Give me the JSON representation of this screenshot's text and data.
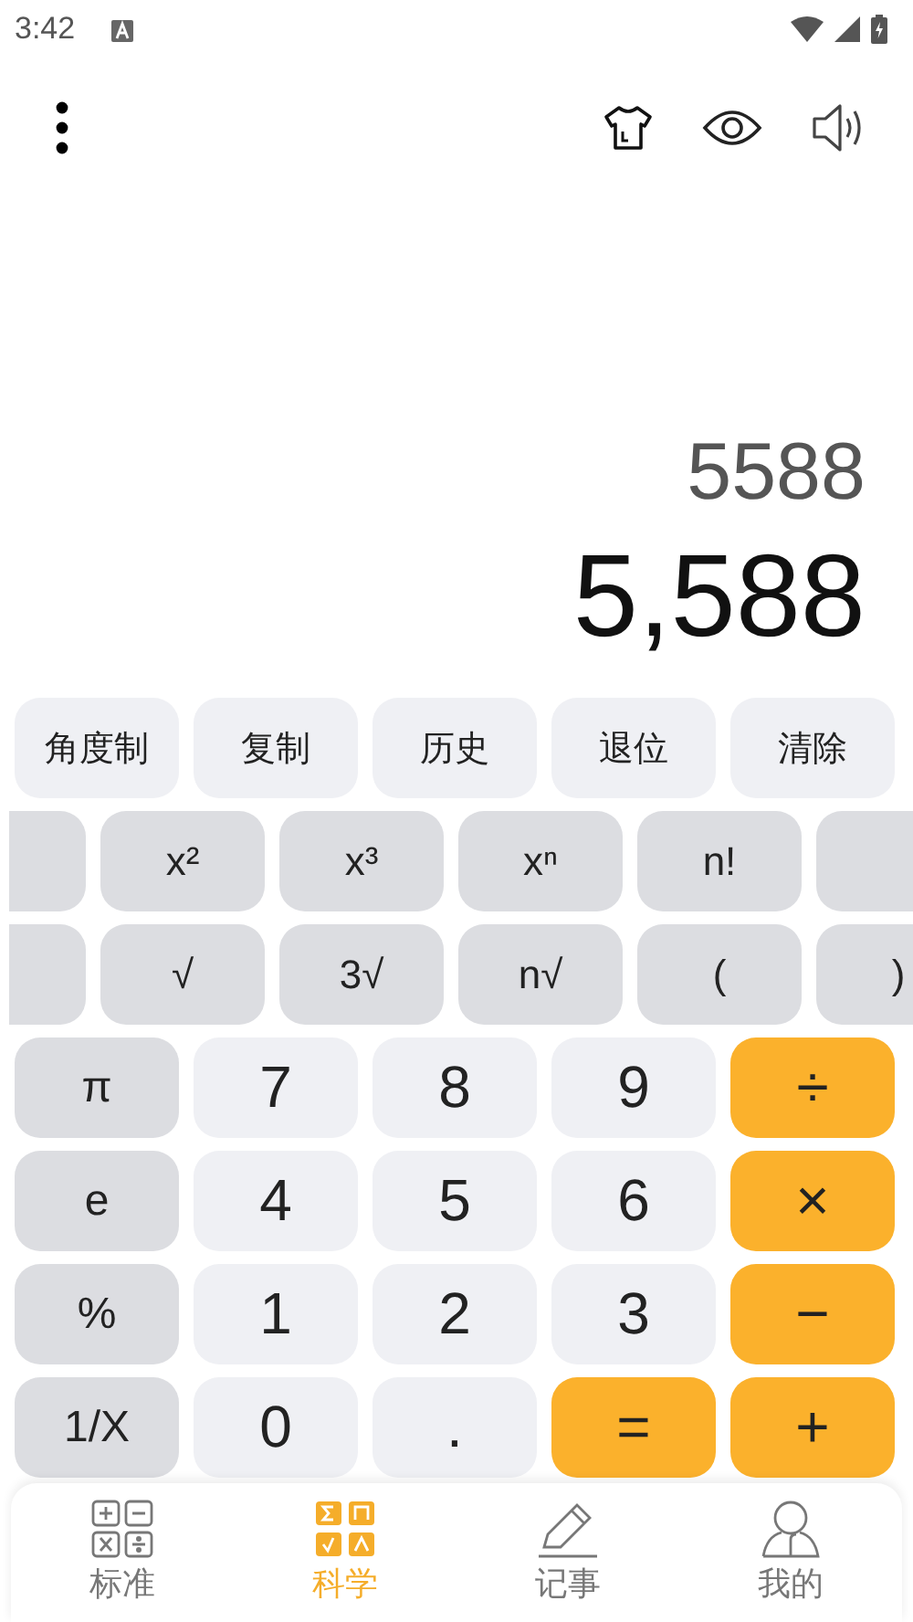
{
  "status_bar": {
    "time": "3:42"
  },
  "display": {
    "expression": "5588",
    "result": "5,588"
  },
  "function_row": [
    "角度制",
    "复制",
    "历史",
    "退位",
    "清除"
  ],
  "scientific_rows": [
    [
      "x²",
      "x³",
      "xⁿ",
      "n!"
    ],
    [
      "√",
      "3√",
      "n√",
      "(",
      ")"
    ]
  ],
  "keypad": [
    [
      {
        "label": "π",
        "kind": "fn"
      },
      {
        "label": "7",
        "kind": "num"
      },
      {
        "label": "8",
        "kind": "num"
      },
      {
        "label": "9",
        "kind": "num"
      },
      {
        "label": "÷",
        "kind": "op"
      }
    ],
    [
      {
        "label": "e",
        "kind": "fn"
      },
      {
        "label": "4",
        "kind": "num"
      },
      {
        "label": "5",
        "kind": "num"
      },
      {
        "label": "6",
        "kind": "num"
      },
      {
        "label": "×",
        "kind": "op"
      }
    ],
    [
      {
        "label": "%",
        "kind": "fn"
      },
      {
        "label": "1",
        "kind": "num"
      },
      {
        "label": "2",
        "kind": "num"
      },
      {
        "label": "3",
        "kind": "num"
      },
      {
        "label": "−",
        "kind": "op"
      }
    ],
    [
      {
        "label": "1/X",
        "kind": "fn"
      },
      {
        "label": "0",
        "kind": "num"
      },
      {
        "label": ".",
        "kind": "num"
      },
      {
        "label": "=",
        "kind": "op"
      },
      {
        "label": "+",
        "kind": "op"
      }
    ]
  ],
  "bottom_nav": [
    {
      "label": "标准",
      "kind": "standard",
      "selected": false
    },
    {
      "label": "科学",
      "kind": "science",
      "selected": true
    },
    {
      "label": "记事",
      "kind": "notes",
      "selected": false
    },
    {
      "label": "我的",
      "kind": "profile",
      "selected": false
    }
  ]
}
